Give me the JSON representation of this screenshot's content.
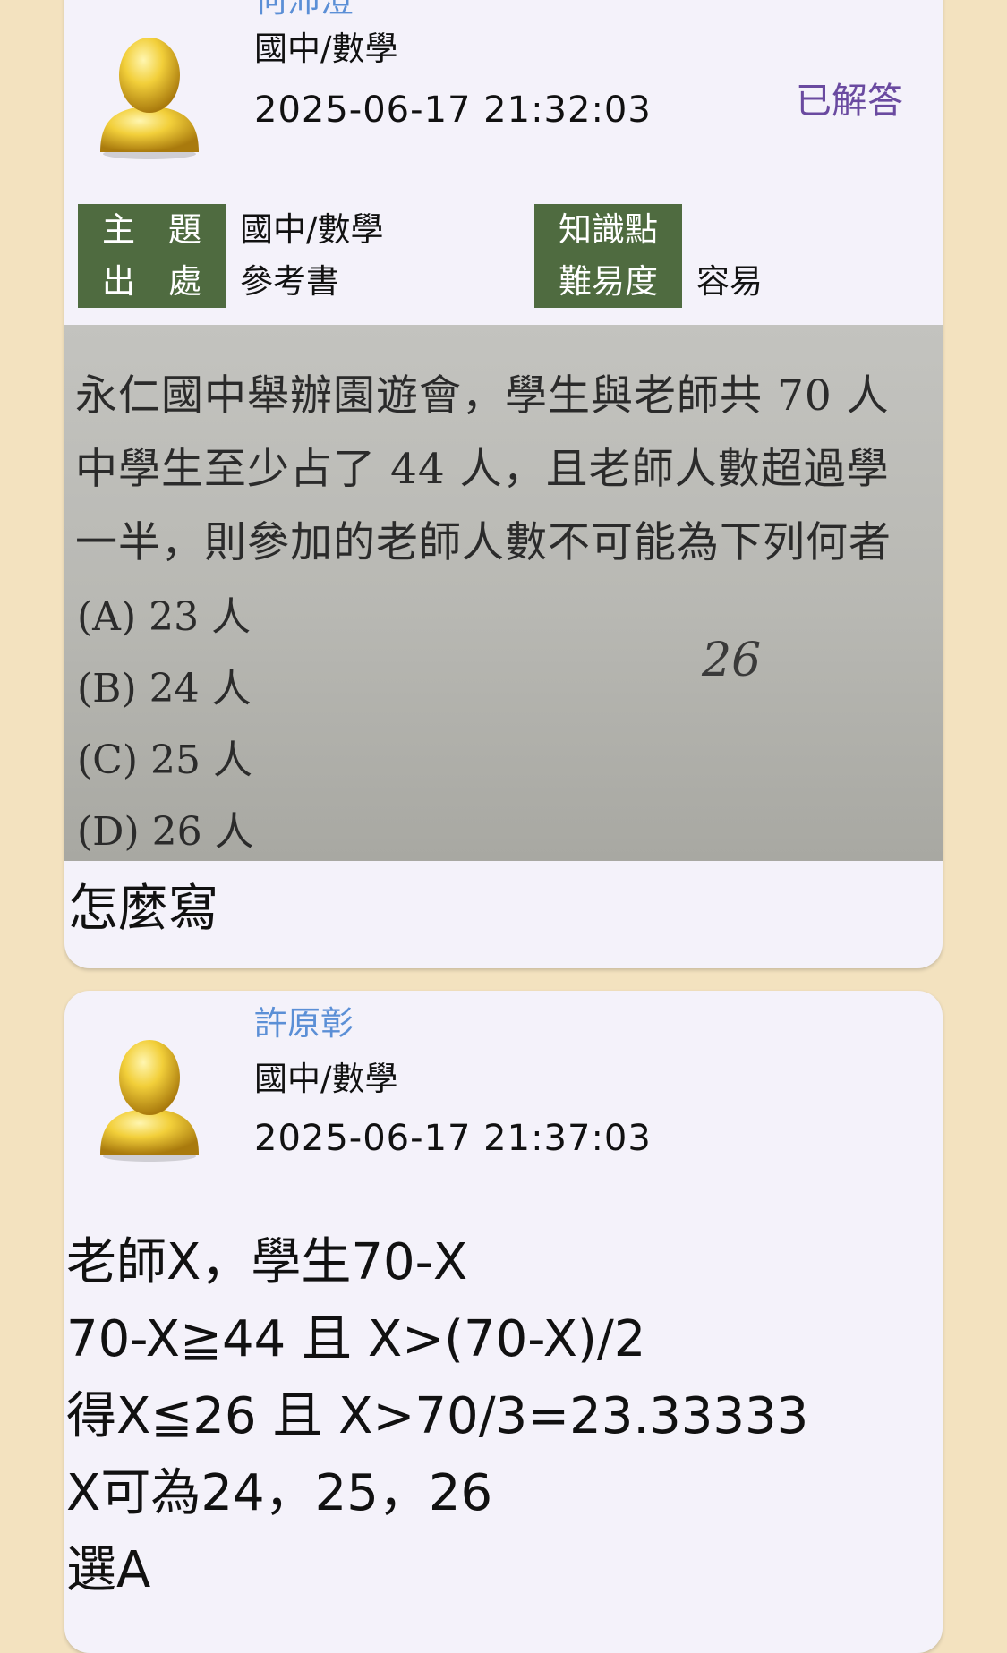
{
  "question_card": {
    "author": "何沛澄",
    "category": "國中/數學",
    "timestamp": "2025-06-17 21:32:03",
    "status": "已解答",
    "tags": {
      "topic_label": "主　題",
      "topic_value": "國中/數學",
      "source_label": "出　處",
      "source_value": "參考書",
      "knowledge_label": "知識點",
      "knowledge_value": "",
      "difficulty_label": "難易度",
      "difficulty_value": "容易"
    },
    "photo": {
      "line1": "永仁國中舉辦園遊會，學生與老師共 70 人",
      "line2": "中學生至少占了 44 人，且老師人數超過學",
      "line3": "一半，則參加的老師人數不可能為下列何者",
      "options": [
        "(A) 23 人",
        "(B) 24 人",
        "(C) 25 人",
        "(D) 26 人"
      ],
      "handwriting": "26"
    },
    "question_text": "怎麼寫"
  },
  "answer_card": {
    "author": "許原彰",
    "category": "國中/數學",
    "timestamp": "2025-06-17 21:37:03",
    "lines": [
      "老師X，學生70-X",
      "70-X≧44 且 X>(70-X)/2",
      "得X≦26 且 X>70/3=23.33333",
      "X可為24，25，26",
      "選A"
    ]
  },
  "colors": {
    "background": "#f3e2bf",
    "card": "#f4f2fa",
    "author": "#5b8fd6",
    "status": "#6a4aa0",
    "tag_box": "#4f6b40"
  },
  "icons": {
    "avatar": "user-bust-icon"
  }
}
